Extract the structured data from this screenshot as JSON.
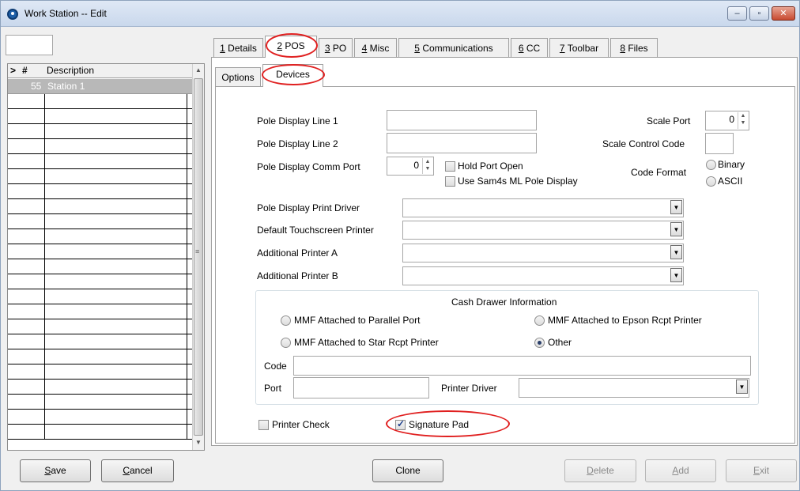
{
  "window": {
    "title": "Work Station -- Edit",
    "controls": [
      "–",
      "▫",
      "✕"
    ]
  },
  "list": {
    "headers": {
      "marker": ">",
      "number": "#",
      "description": "Description"
    },
    "rows": [
      {
        "number": "55",
        "description": "Station 1"
      }
    ],
    "scroll_grip": "≡"
  },
  "tabs": [
    {
      "key": "1",
      "rest": " Details"
    },
    {
      "key": "2",
      "rest": " POS"
    },
    {
      "key": "3",
      "rest": " PO"
    },
    {
      "key": "4",
      "rest": " Misc"
    },
    {
      "key": "5",
      "rest": " Communications"
    },
    {
      "key": "6",
      "rest": " CC"
    },
    {
      "key": "7",
      "rest": " Toolbar"
    },
    {
      "key": "8",
      "rest": " Files"
    }
  ],
  "subtabs": [
    "Options",
    "Devices"
  ],
  "devices": {
    "pole_line1_label": "Pole Display Line 1",
    "pole_line2_label": "Pole Display Line 2",
    "pole_comm_port_label": "Pole Display Comm Port",
    "pole_comm_port_value": "0",
    "hold_port_open_label": "Hold Port Open",
    "use_sam4s_label": "Use Sam4s ML Pole Display",
    "scale_port_label": "Scale Port",
    "scale_port_value": "0",
    "scale_control_code_label": "Scale Control Code",
    "code_format_label": "Code Format",
    "binary_label": "Binary",
    "ascii_label": "ASCII",
    "pole_print_driver_label": "Pole Display Print Driver",
    "default_touch_printer_label": "Default Touchscreen Printer",
    "additional_printer_a_label": "Additional Printer A",
    "additional_printer_b_label": "Additional Printer B"
  },
  "cash_drawer": {
    "title": "Cash Drawer Information",
    "opt_parallel": "MMF Attached to Parallel Port",
    "opt_epson": "MMF Attached to Epson Rcpt Printer",
    "opt_star": "MMF Attached to Star Rcpt Printer",
    "opt_other": "Other",
    "selected": "Other",
    "code_label": "Code",
    "port_label": "Port",
    "printer_driver_label": "Printer Driver"
  },
  "printer_check_label": "Printer Check",
  "signature_pad_label": "Signature Pad",
  "signature_pad_checked": true,
  "buttons": {
    "save": {
      "key": "S",
      "rest": "ave"
    },
    "cancel": {
      "key": "C",
      "rest": "ancel"
    },
    "clone": "Clone",
    "delete": {
      "key": "D",
      "rest": "elete"
    },
    "add": {
      "key": "A",
      "rest": "dd"
    },
    "exit": {
      "key": "E",
      "rest": "xit"
    }
  },
  "colors": {
    "highlight_ring": "#e02020",
    "selected_row": "#b8b8b8"
  }
}
